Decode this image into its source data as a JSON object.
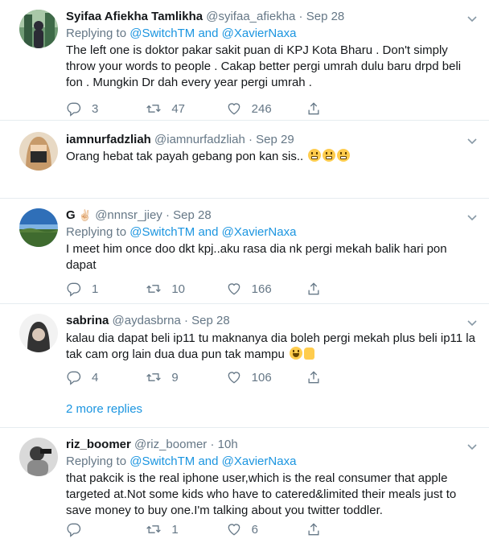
{
  "tweets": [
    {
      "name": "Syifaa Afiekha Tamlikha",
      "handle": "@syifaa_afiekha",
      "sep": "·",
      "time": "Sep 28",
      "replying_prefix": "Replying to",
      "replying_mentions": "@SwitchTM and @XavierNaxa",
      "text": "The left one is doktor pakar sakit puan di KPJ Kota Bharu . Don't simply throw your words to people . Cakap better pergi umrah dulu baru drpd beli fon . Mungkin Dr dah every year pergi umrah .",
      "replies": "3",
      "retweets": "47",
      "likes": "246",
      "avatar_colors": [
        "#3a6d4d",
        "#8bb38f",
        "#2b2b35"
      ]
    },
    {
      "name": "iamnurfadzliah",
      "handle": "@iamnurfadzliah",
      "sep": "·",
      "time": "Sep 29",
      "text": "Orang hebat tak payah gebang pon kan sis..",
      "replies": "",
      "retweets": "",
      "likes": "",
      "avatar_colors": [
        "#e8d9c4",
        "#c79a6a",
        "#2a2a2a"
      ]
    },
    {
      "name": "G",
      "name_emoji": "✌🏻",
      "handle": "@nnnsr_jiey",
      "sep": "·",
      "time": "Sep 28",
      "replying_prefix": "Replying to",
      "replying_mentions": "@SwitchTM and @XavierNaxa",
      "text": "I meet him once doo dkt kpj..aku rasa dia nk pergi mekah balik hari pon dapat",
      "replies": "1",
      "retweets": "10",
      "likes": "166",
      "avatar_colors": [
        "#2f6fb8",
        "#7fb3e3",
        "#3f6b2f"
      ]
    },
    {
      "name": "sabrina",
      "handle": "@aydasbrna",
      "sep": "·",
      "time": "Sep 28",
      "text": "kalau dia dapat beli ip11 tu maknanya dia boleh pergi mekah plus beli ip11 la tak cam org lain dua dua pun tak mampu",
      "replies": "4",
      "retweets": "9",
      "likes": "106",
      "avatar_colors": [
        "#f2f2f2",
        "#d9c7b8",
        "#333333"
      ]
    },
    {
      "name": "riz_boomer",
      "handle": "@riz_boomer",
      "sep": "·",
      "time": "10h",
      "replying_prefix": "Replying to",
      "replying_mentions": "@SwitchTM and @XavierNaxa",
      "text": "that pakcik is the real iphone user,which is the real consumer that apple targeted at.Not some kids who have to catered&limited their meals just to save money to buy one.I'm talking about you twitter toddler.",
      "replies": "",
      "retweets": "1",
      "likes": "6",
      "avatar_colors": [
        "#d9d9d9",
        "#8a8a8a",
        "#3b3b3b"
      ]
    }
  ],
  "more_replies": "2 more replies",
  "colors": {
    "link": "#1b95e0",
    "muted": "#657786",
    "text": "#14171a",
    "divider": "#e6ecf0"
  }
}
